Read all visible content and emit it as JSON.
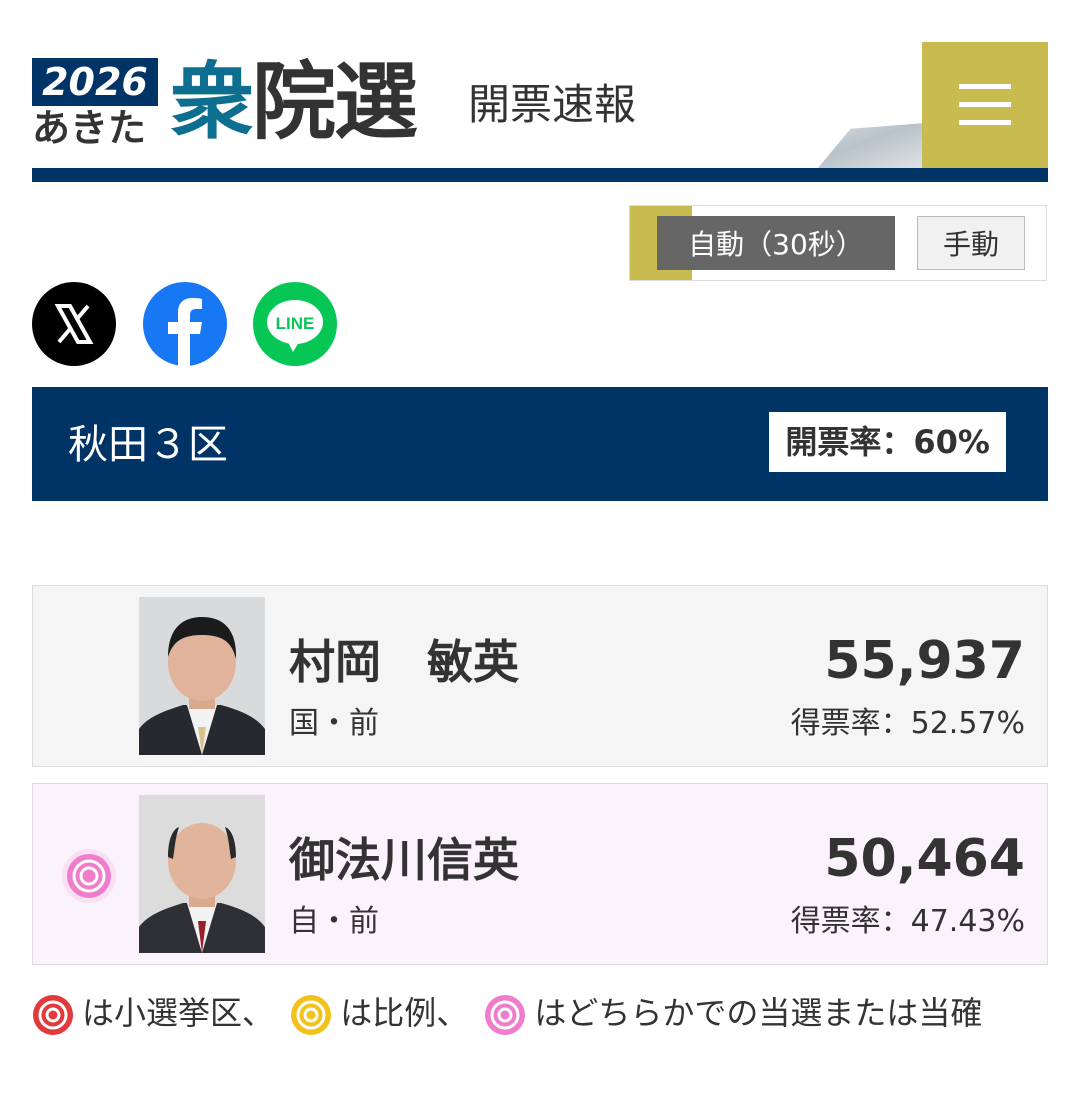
{
  "header": {
    "year": "2026",
    "region": "あきた",
    "title_accent": "衆",
    "title_rest": "院選",
    "tagline": "開票速報",
    "menu_icon": "hamburger-icon"
  },
  "update": {
    "auto_label": "自動（30秒）",
    "manual_label": "手動",
    "selected": "auto"
  },
  "social": [
    {
      "name": "X",
      "icon": "x-icon",
      "color": "#000000"
    },
    {
      "name": "Facebook",
      "icon": "facebook-icon",
      "color": "#1877f2"
    },
    {
      "name": "LINE",
      "icon": "line-icon",
      "color": "#06c755",
      "text": "LINE"
    }
  ],
  "district": {
    "name": "秋田３区",
    "count_rate": "開票率：60%"
  },
  "candidates": [
    {
      "name": "村岡　敏英",
      "party": "国・前",
      "votes": "55,937",
      "vote_share": "得票率：52.57%",
      "badge": null
    },
    {
      "name": "御法川信英",
      "party": "自・前",
      "votes": "50,464",
      "vote_share": "得票率：47.43%",
      "badge": "pink-rose"
    }
  ],
  "legend": {
    "red_text": "は小選挙区、",
    "yellow_text": "は比例、",
    "pink_text": "はどちらかでの当選または当確"
  },
  "colors": {
    "navy": "#003366",
    "gold": "#c8bb50",
    "rose_red": "#e03a3a",
    "rose_yellow": "#f2c21a",
    "rose_pink": "#f07ccc"
  }
}
